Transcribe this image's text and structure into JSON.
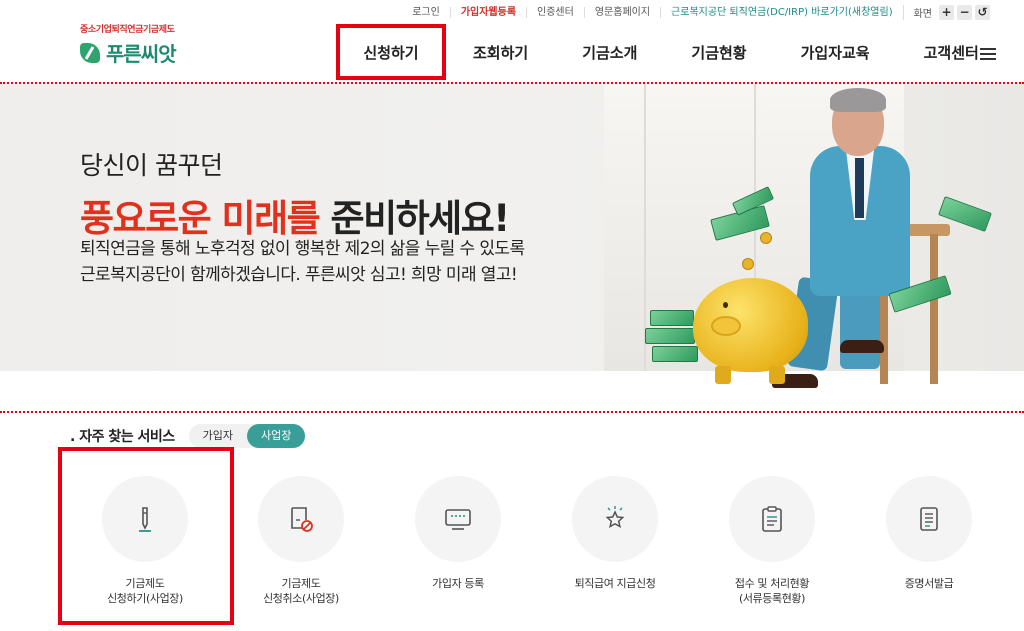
{
  "utility": {
    "login": "로그인",
    "signup": "가입자웹등록",
    "cert": "인증센터",
    "english": "영문홈페이지",
    "dcirp": "근로복지공단 퇴직연금(DC/IRP) 바로가기(새창열림)",
    "zoom_label": "화면",
    "zoom_in": "+",
    "zoom_out": "−",
    "zoom_reset": "↺"
  },
  "logo": {
    "tagline": "중소기업퇴직연금기금제도",
    "name": "푸른씨앗"
  },
  "nav": {
    "items": [
      "신청하기",
      "조회하기",
      "기금소개",
      "기금현황",
      "가입자교육",
      "고객센터"
    ]
  },
  "hero": {
    "subtitle": "당신이 꿈꾸던",
    "title_red": "풍요로운 미래를",
    "title_dark": " 준비하세요!",
    "desc_line1": "퇴직연금을 통해 노후걱정 없이 행복한 제2의 삶을 누릴 수 있도록",
    "desc_line2": "근로복지공단이 함께하겠습니다. 푸른씨앗 심고! 희망 미래 열고!"
  },
  "frequent": {
    "title": ". 자주 찾는 서비스",
    "toggle": [
      "가입자",
      "사업장"
    ],
    "items": [
      {
        "line1": "기금제도",
        "line2": "신청하기(사업장)",
        "icon": "pen-icon"
      },
      {
        "line1": "기금제도",
        "line2": "신청취소(사업장)",
        "icon": "cancel-document-icon"
      },
      {
        "line1": "가입자 등록",
        "line2": "",
        "icon": "monitor-icon"
      },
      {
        "line1": "퇴직급여 지급신청",
        "line2": "",
        "icon": "star-icon"
      },
      {
        "line1": "접수 및 처리현황",
        "line2": "(서류등록현황)",
        "icon": "clipboard-icon"
      },
      {
        "line1": "증명서발급",
        "line2": "",
        "icon": "certificate-icon"
      }
    ]
  },
  "colors": {
    "accent_red": "#e60012",
    "teal": "#3a9e98",
    "brand_green": "#1e8a72"
  }
}
